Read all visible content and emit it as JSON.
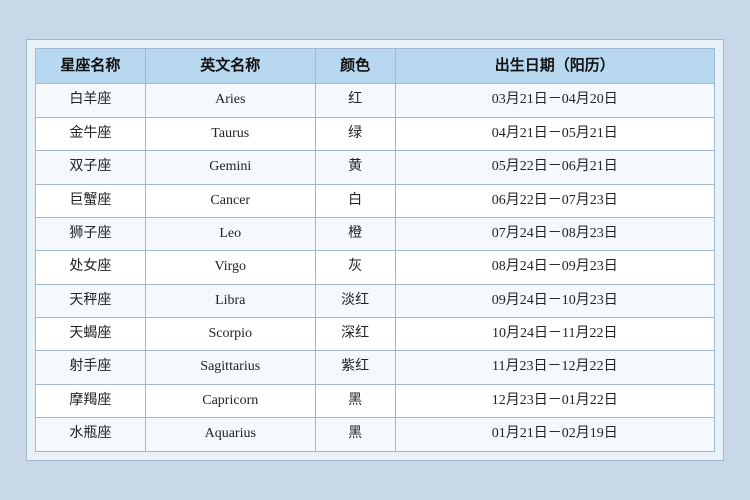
{
  "table": {
    "headers": [
      "星座名称",
      "英文名称",
      "颜色",
      "出生日期（阳历）"
    ],
    "rows": [
      {
        "chinese": "白羊座",
        "english": "Aries",
        "color": "红",
        "date": "03月21日－04月20日"
      },
      {
        "chinese": "金牛座",
        "english": "Taurus",
        "color": "绿",
        "date": "04月21日－05月21日"
      },
      {
        "chinese": "双子座",
        "english": "Gemini",
        "color": "黄",
        "date": "05月22日－06月21日"
      },
      {
        "chinese": "巨蟹座",
        "english": "Cancer",
        "color": "白",
        "date": "06月22日－07月23日"
      },
      {
        "chinese": "狮子座",
        "english": "Leo",
        "color": "橙",
        "date": "07月24日－08月23日"
      },
      {
        "chinese": "处女座",
        "english": "Virgo",
        "color": "灰",
        "date": "08月24日－09月23日"
      },
      {
        "chinese": "天秤座",
        "english": "Libra",
        "color": "淡红",
        "date": "09月24日－10月23日"
      },
      {
        "chinese": "天蝎座",
        "english": "Scorpio",
        "color": "深红",
        "date": "10月24日－11月22日"
      },
      {
        "chinese": "射手座",
        "english": "Sagittarius",
        "color": "紫红",
        "date": "11月23日－12月22日"
      },
      {
        "chinese": "摩羯座",
        "english": "Capricorn",
        "color": "黑",
        "date": "12月23日－01月22日"
      },
      {
        "chinese": "水瓶座",
        "english": "Aquarius",
        "color": "黑",
        "date": "01月21日－02月19日"
      }
    ]
  }
}
